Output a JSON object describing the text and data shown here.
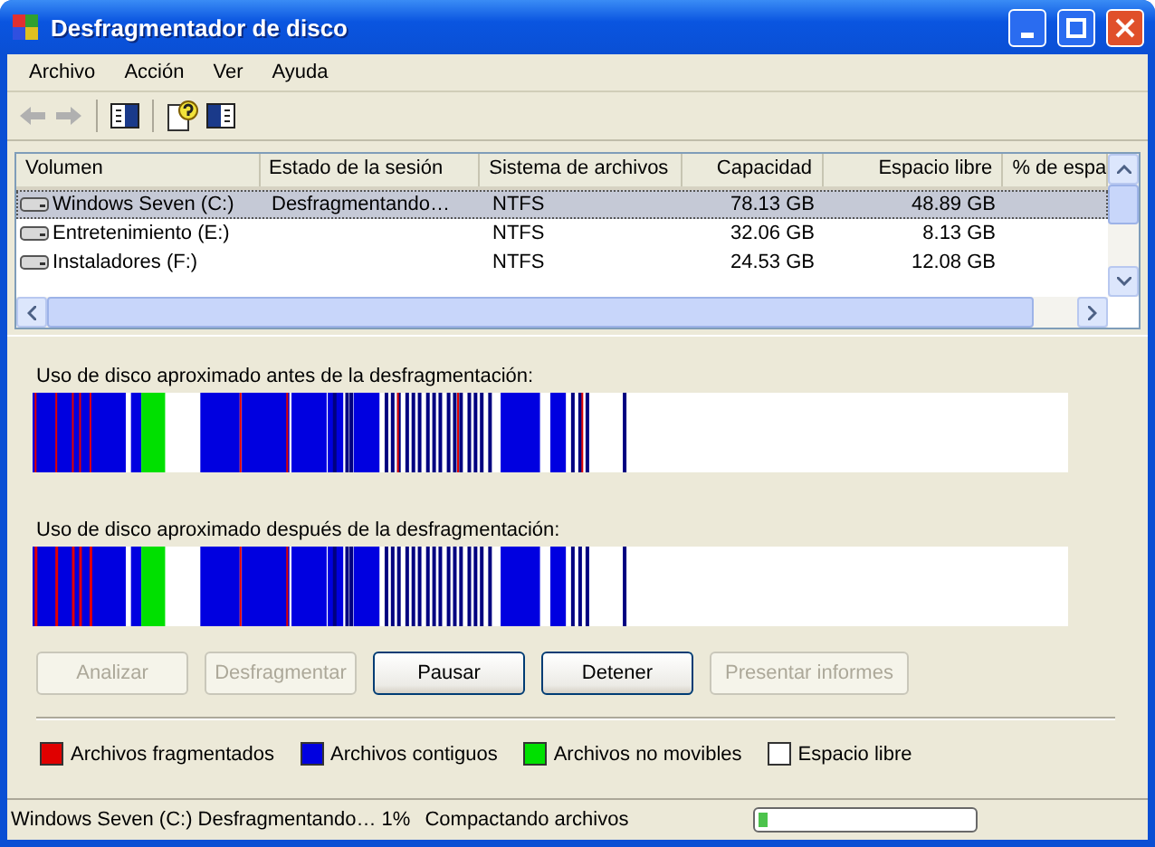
{
  "window": {
    "title": "Desfragmentador de disco"
  },
  "menu": [
    "Archivo",
    "Acción",
    "Ver",
    "Ayuda"
  ],
  "table": {
    "columns": [
      "Volumen",
      "Estado de la sesión",
      "Sistema de archivos",
      "Capacidad",
      "Espacio libre",
      "% de espa"
    ],
    "rows": [
      {
        "cells": [
          "Windows Seven (C:)",
          "Desfragmentando…",
          "NTFS",
          "78.13 GB",
          "48.89 GB"
        ],
        "selected": true
      },
      {
        "cells": [
          "Entretenimiento (E:)",
          "",
          "NTFS",
          "32.06 GB",
          "8.13 GB"
        ],
        "selected": false
      },
      {
        "cells": [
          "Instaladores (F:)",
          "",
          "NTFS",
          "24.53 GB",
          "12.08 GB"
        ],
        "selected": false
      }
    ]
  },
  "maps": [
    {
      "label": "Uso de disco aproximado antes de la desfragmentación:"
    },
    {
      "label": "Uso de disco aproximado después de la desfragmentación:"
    }
  ],
  "buttons": [
    {
      "label": "Analizar",
      "disabled": true
    },
    {
      "label": "Desfragmentar",
      "disabled": true
    },
    {
      "label": "Pausar",
      "disabled": false
    },
    {
      "label": "Detener",
      "disabled": false
    },
    {
      "label": "Presentar informes",
      "disabled": true
    }
  ],
  "legend": [
    {
      "label": "Archivos fragmentados",
      "color": "#e00000"
    },
    {
      "label": "Archivos contiguos",
      "color": "#0000e0"
    },
    {
      "label": "Archivos no movibles",
      "color": "#00e000"
    },
    {
      "label": "Espacio libre",
      "color": "#ffffff"
    }
  ],
  "status_bar": {
    "volume_status": "Windows Seven (C:) Desfragmentando… 1%",
    "task": "Compactando archivos",
    "progress": {
      "level": 0.04
    }
  }
}
